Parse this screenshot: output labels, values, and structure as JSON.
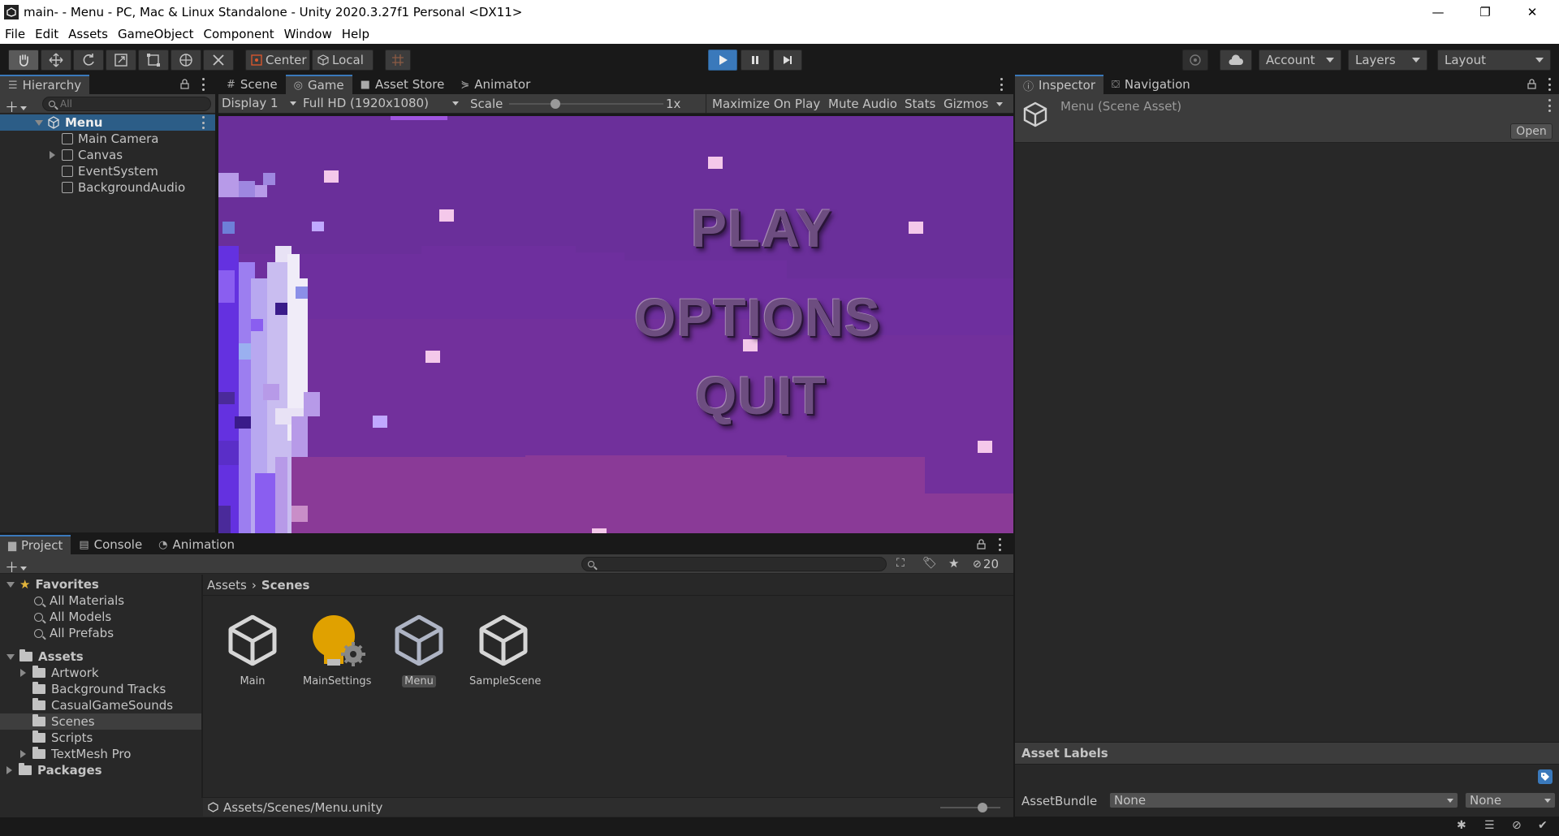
{
  "window": {
    "title": "main- - Menu - PC, Mac & Linux Standalone - Unity 2020.3.27f1 Personal <DX11>",
    "minimize": "—",
    "maximize": "❐",
    "close": "✕"
  },
  "menubar": [
    "File",
    "Edit",
    "Assets",
    "GameObject",
    "Component",
    "Window",
    "Help"
  ],
  "toolbar": {
    "pivot": "Center",
    "space": "Local",
    "account": "Account",
    "layers": "Layers",
    "layout": "Layout"
  },
  "hierarchy": {
    "tab": "Hierarchy",
    "search_placeholder": "All",
    "scene": "Menu",
    "items": [
      "Main Camera",
      "Canvas",
      "EventSystem",
      "BackgroundAudio"
    ]
  },
  "center_tabs": [
    "Scene",
    "Game",
    "Asset Store",
    "Animator"
  ],
  "game": {
    "display": "Display 1",
    "resolution": "Full HD (1920x1080)",
    "scale_label": "Scale",
    "scale_value": "1x",
    "scale_fraction": 0.3,
    "maximize": "Maximize On Play",
    "mute": "Mute Audio",
    "stats": "Stats",
    "gizmos": "Gizmos",
    "menu": [
      "PLAY",
      "OPTIONS",
      "QUIT"
    ]
  },
  "inspector": {
    "tabs": [
      "Inspector",
      "Navigation"
    ],
    "asset_title": "Menu (Scene Asset)",
    "open_button": "Open",
    "labels_header": "Asset Labels",
    "assetbundle_label": "AssetBundle",
    "assetbundle_value": "None",
    "variant_value": "None"
  },
  "bottom_tabs": [
    "Project",
    "Console",
    "Animation"
  ],
  "project": {
    "hidden_count": "20",
    "favorites": "Favorites",
    "favorite_items": [
      "All Materials",
      "All Models",
      "All Prefabs"
    ],
    "assets_root": "Assets",
    "folders": [
      "Artwork",
      "Background Tracks",
      "CasualGameSounds",
      "Scenes",
      "Scripts",
      "TextMesh Pro"
    ],
    "packages": "Packages",
    "breadcrumb": [
      "Assets",
      "Scenes"
    ],
    "files": [
      "Main",
      "MainSettings",
      "Menu",
      "SampleScene"
    ],
    "path": "Assets/Scenes/Menu.unity",
    "zoom_fraction": 0.7
  },
  "colors": {
    "accent": "#3a79bb",
    "game_bg": "#6a2f9a",
    "play_active": "#3a79bb"
  }
}
